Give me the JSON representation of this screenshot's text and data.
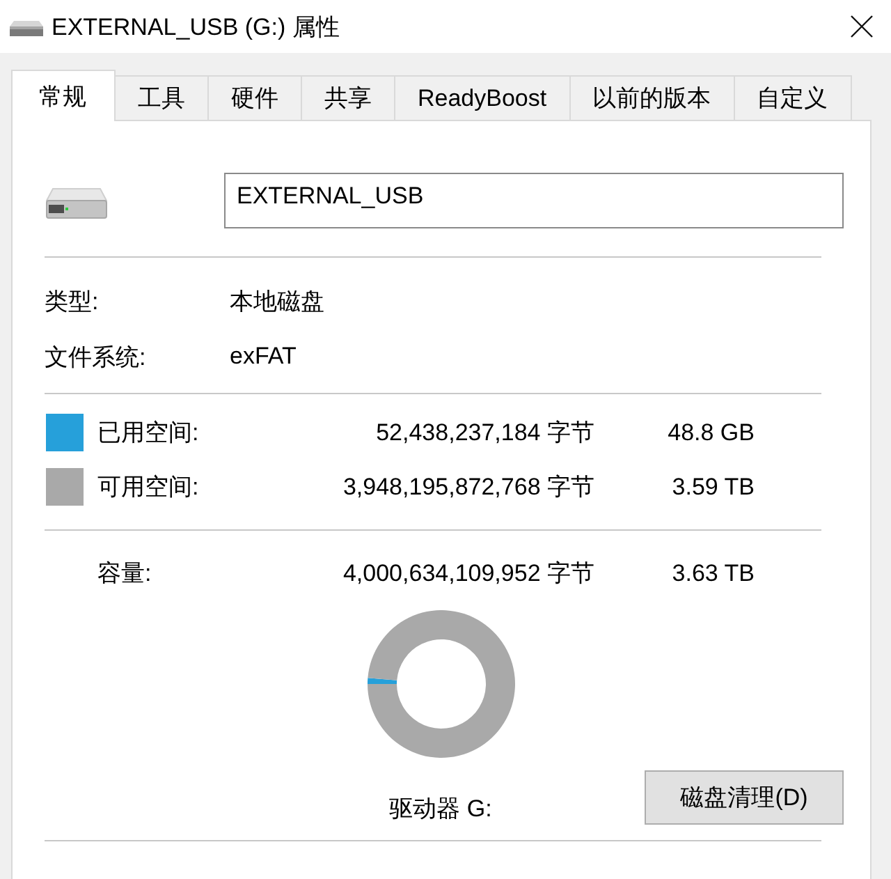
{
  "window": {
    "title": "EXTERNAL_USB (G:) 属性"
  },
  "tabs": [
    {
      "label": "常规",
      "selected": true
    },
    {
      "label": "工具",
      "selected": false
    },
    {
      "label": "硬件",
      "selected": false
    },
    {
      "label": "共享",
      "selected": false
    },
    {
      "label": "ReadyBoost",
      "selected": false
    },
    {
      "label": "以前的版本",
      "selected": false
    },
    {
      "label": "自定义",
      "selected": false
    }
  ],
  "general": {
    "name_field": {
      "value": "EXTERNAL_USB"
    },
    "properties": [
      {
        "label": "类型:",
        "value": "本地磁盘"
      },
      {
        "label": "文件系统:",
        "value": "exFAT"
      }
    ],
    "space": [
      {
        "label": "已用空间:",
        "bytes": "52,438,237,184 字节",
        "size": "48.8 GB",
        "color": "#26a0da"
      },
      {
        "label": "可用空间:",
        "bytes": "3,948,195,872,768 字节",
        "size": "3.59 TB",
        "color": "#a9a9a9"
      }
    ],
    "capacity": {
      "label": "容量:",
      "bytes": "4,000,634,109,952 字节",
      "size": "3.63 TB"
    },
    "chart_data": {
      "type": "donut",
      "values": [
        1.31,
        98.69
      ]
    },
    "drive_label": "驱动器 G:",
    "cleanup_button": "磁盘清理(D)"
  }
}
